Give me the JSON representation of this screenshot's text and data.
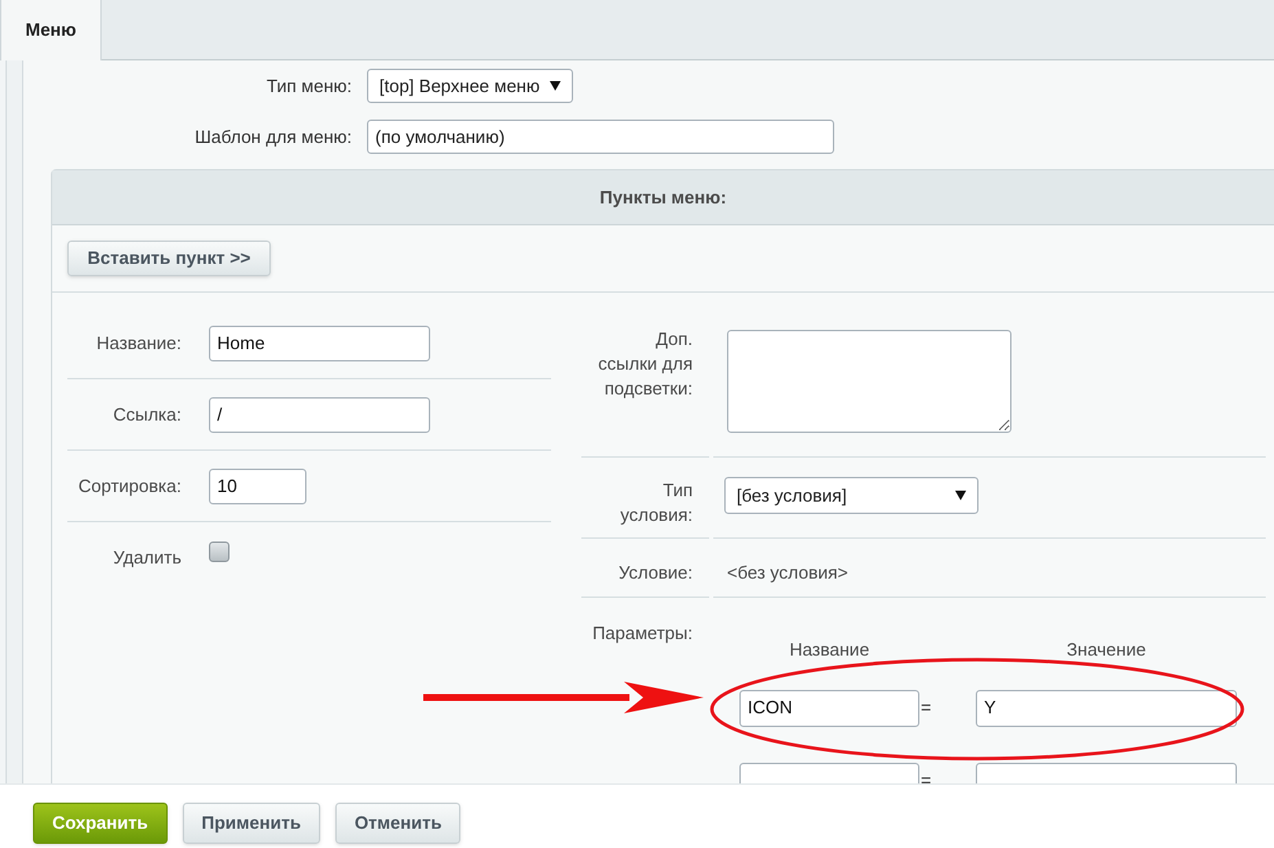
{
  "tabs": [
    {
      "label": "Меню",
      "selected": true
    }
  ],
  "menu_type": {
    "label": "Тип меню:",
    "value": "[top] Верхнее меню"
  },
  "template": {
    "label": "Шаблон для меню:",
    "value": "(по умолчанию)"
  },
  "items_panel": {
    "title": "Пункты меню:",
    "insert_button": "Вставить пункт >>",
    "fields": [
      {
        "kind": "text",
        "label": "Название:",
        "value": "Home"
      },
      {
        "kind": "text",
        "label": "Ссылка:",
        "value": "/"
      },
      {
        "kind": "number",
        "label": "Сортировка:",
        "value": "10"
      },
      {
        "kind": "checkbox",
        "label": "Удалить",
        "checked": false
      }
    ],
    "highlight_links": {
      "label": "Доп. ссылки для подсветки:"
    },
    "condition_type": {
      "label": "Тип условия:",
      "value": "[без условия]"
    },
    "condition": {
      "label": "Условие:",
      "value": "<без условия>"
    },
    "parameters": {
      "label": "Параметры:",
      "columns": [
        "Название",
        "Значение"
      ],
      "separator": "=",
      "rows": [
        {
          "kind": "filled",
          "name": "ICON",
          "value": "Y",
          "highlighted": true
        },
        {
          "kind": "empty",
          "highlighted": false
        }
      ]
    }
  },
  "buttons": [
    {
      "label": "Сохранить",
      "kind": "primary"
    },
    {
      "label": "Применить",
      "kind": "secondary"
    },
    {
      "label": "Отменить",
      "kind": "secondary"
    }
  ]
}
